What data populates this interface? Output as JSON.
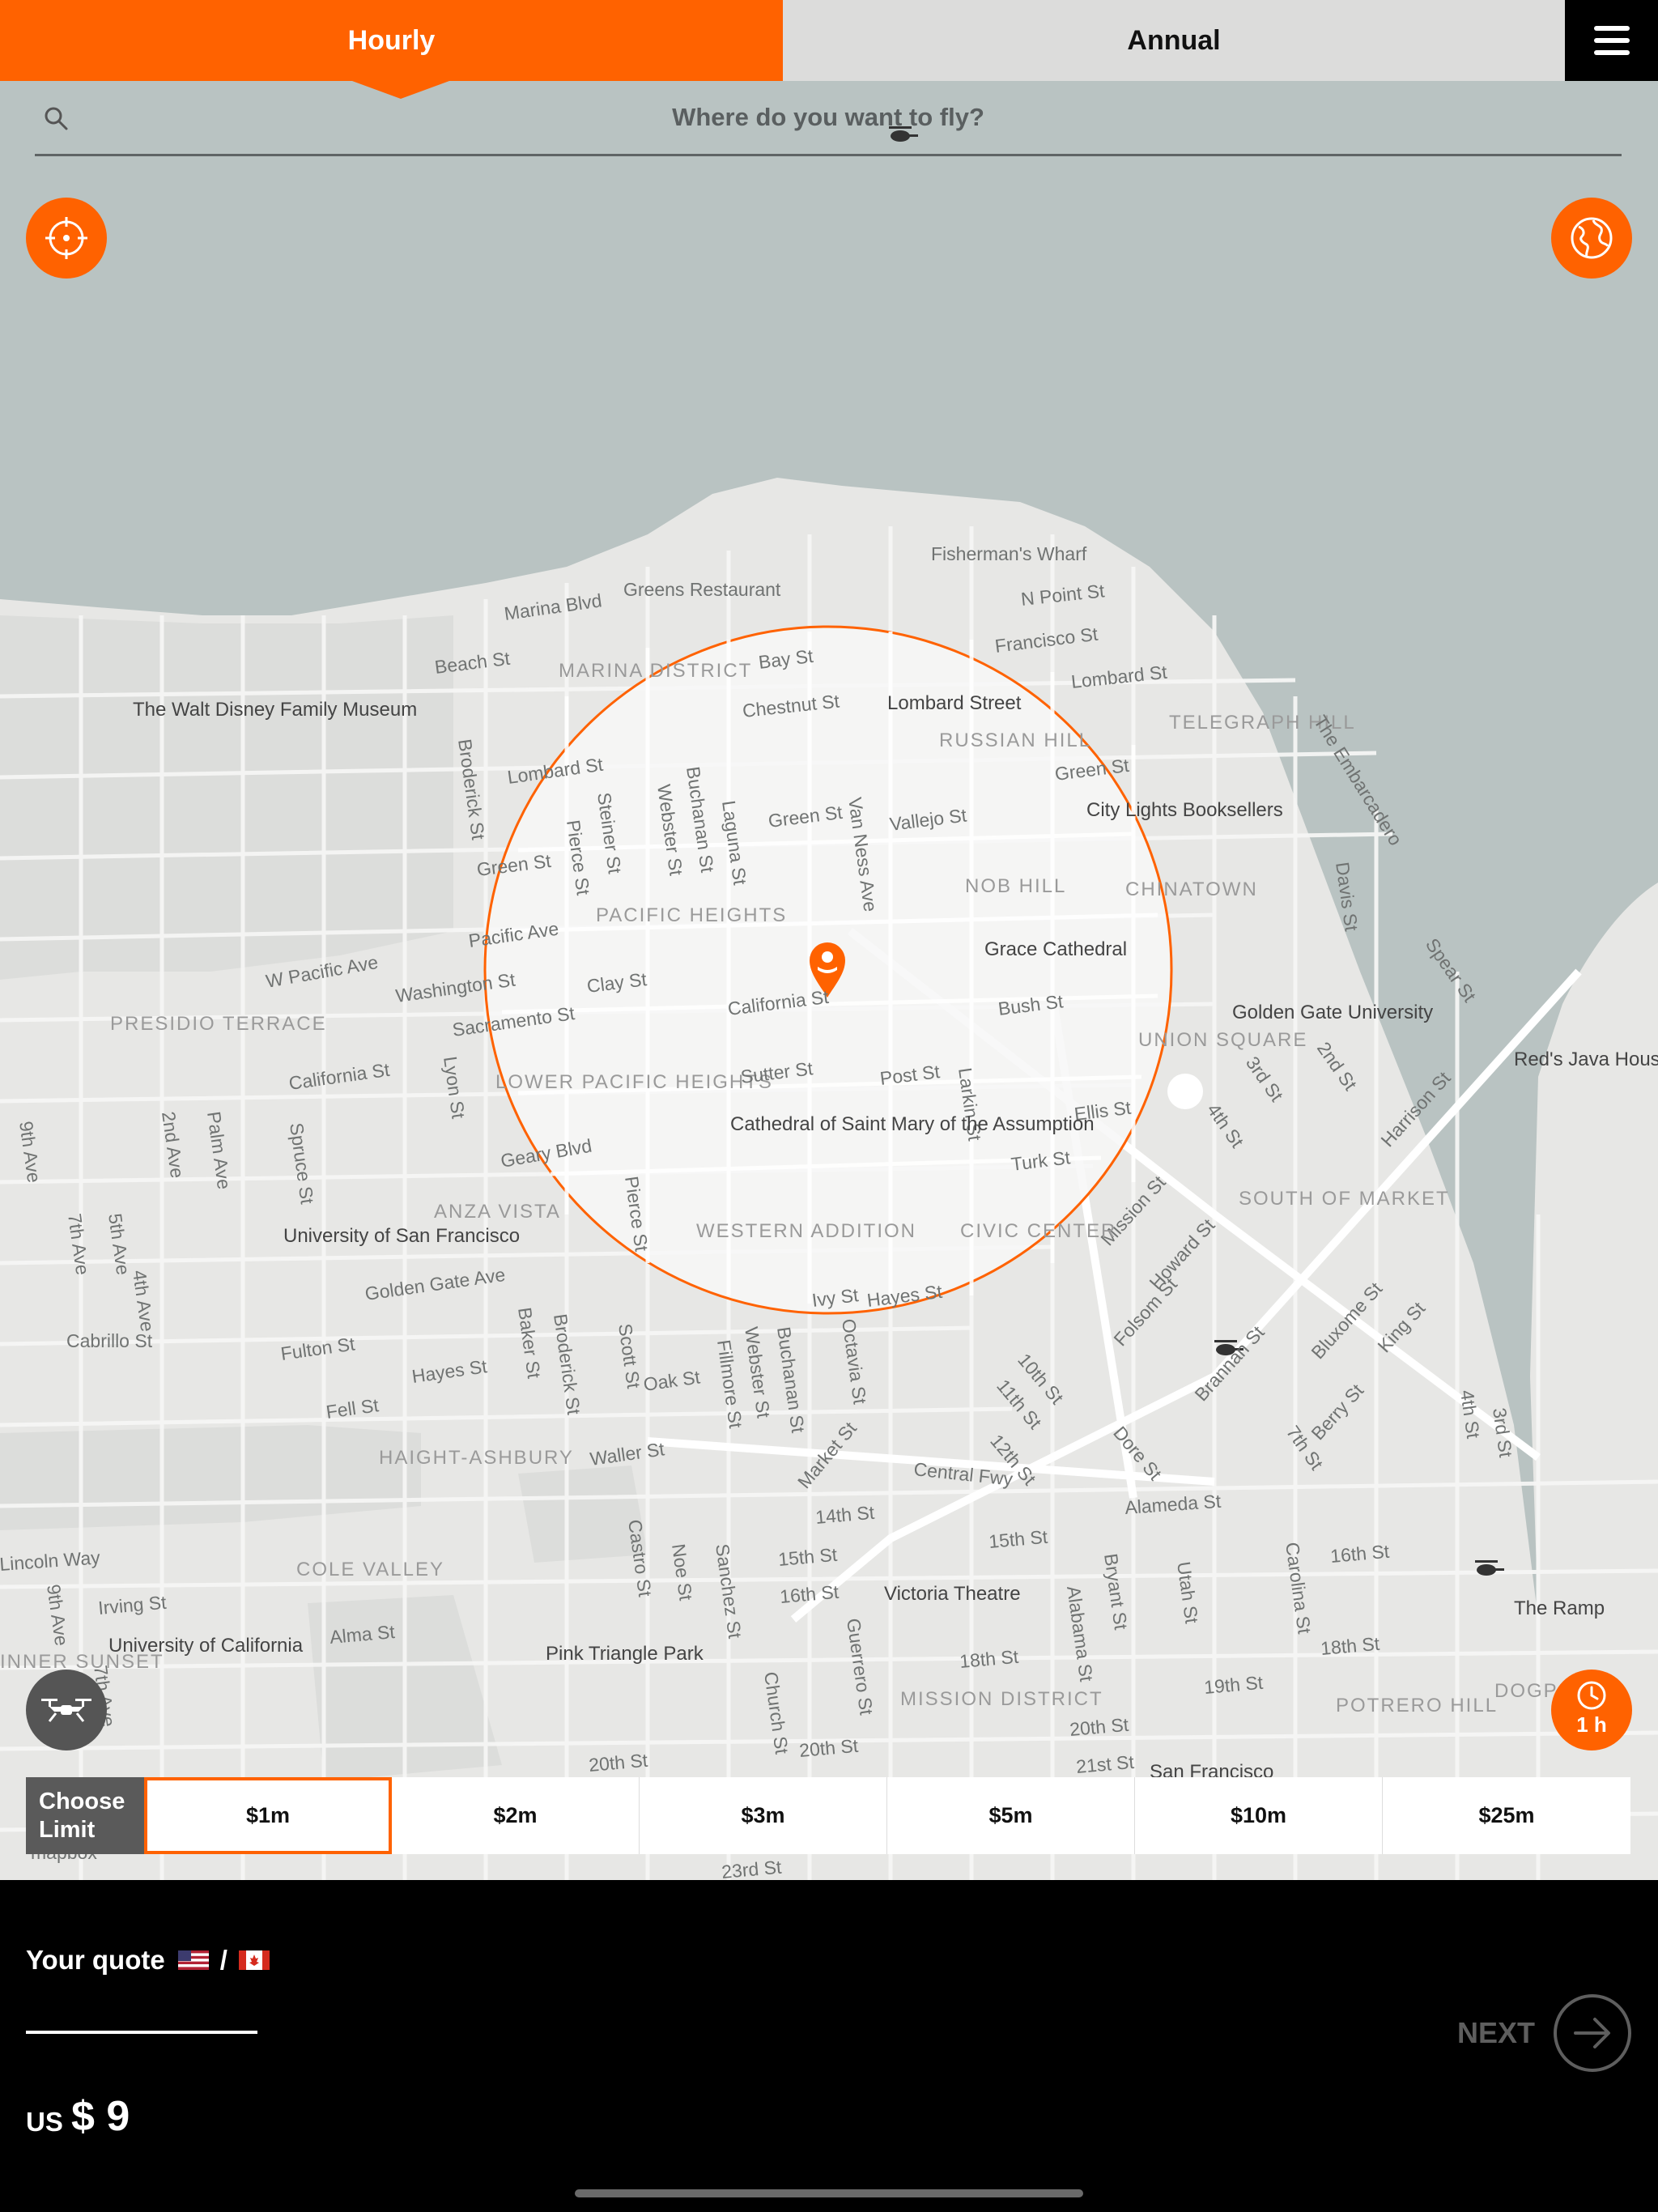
{
  "tabs": {
    "hourly": "Hourly",
    "annual": "Annual"
  },
  "search": {
    "placeholder": "Where do you want to fly?"
  },
  "map": {
    "labels": {
      "fishermans_wharf": "Fisherman's Wharf",
      "n_point_st": "N Point St",
      "greens_restaurant": "Greens Restaurant",
      "marina_blvd": "Marina Blvd",
      "bay_st": "Bay St",
      "francisco_st": "Francisco St",
      "beach_st": "Beach St",
      "marina_district": "MARINA DISTRICT",
      "chestnut_st": "Chestnut St",
      "lombard_street": "Lombard Street",
      "lombard_st_east": "Lombard St",
      "telegraph_hill": "TELEGRAPH HILL",
      "disney_museum": "The Walt Disney Family Museum",
      "russian_hill": "RUSSIAN HILL",
      "the_embarcadero": "The Embarcadero",
      "lombard_st": "Lombard St",
      "broderick_st": "Broderick St",
      "steiner_st": "Steiner St",
      "buchanan_st": "Buchanan St",
      "webster_st": "Webster St",
      "laguna_st": "Laguna St",
      "pierce_st": "Pierce St",
      "green_st": "Green St",
      "green_st_east": "Green St",
      "van_ness_ave": "Van Ness Ave",
      "vallejo_st": "Vallejo St",
      "city_lights": "City Lights Booksellers",
      "green_st_west": "Green St",
      "nob_hill": "NOB HILL",
      "chinatown": "CHINATOWN",
      "davis_st": "Davis St",
      "pacific_heights": "PACIFIC HEIGHTS",
      "pacific_ave": "Pacific Ave",
      "grace_cathedral": "Grace Cathedral",
      "spear_st": "Spear St",
      "w_pacific_ave": "W Pacific Ave",
      "washington_st": "Washington St",
      "clay_st": "Clay St",
      "california_st_mid": "California St",
      "bush_st": "Bush St",
      "golden_gate_univ": "Golden Gate University",
      "presidio_terrace": "PRESIDIO TERRACE",
      "sacramento_st": "Sacramento St",
      "union_square": "UNION SQUARE",
      "reds_java_house": "Red's Java House",
      "california_st": "California St",
      "lyon_st": "Lyon St",
      "lower_pacific_heights": "LOWER PACIFIC HEIGHTS",
      "sutter_st": "Sutter St",
      "post_st": "Post St",
      "larkin_st": "Larkin St",
      "third_st": "3rd St",
      "second_st": "2nd St",
      "harrison_st": "Harrison St",
      "ellis_st": "Ellis St",
      "fourth_st": "4th St",
      "ninth_ave": "9th Ave",
      "second_ave": "2nd Ave",
      "palm_ave": "Palm Ave",
      "spruce_st": "Spruce St",
      "geary_blvd": "Geary Blvd",
      "cathedral_st_mary": "Cathedral of Saint Mary of the Assumption",
      "turk_st": "Turk St",
      "mission_st": "Mission St",
      "howard_st": "Howard St",
      "south_of_market": "SOUTH OF MARKET",
      "anza_vista": "ANZA VISTA",
      "pierce_st_south": "Pierce St",
      "university_sf": "University of San Francisco",
      "western_addition": "WESTERN ADDITION",
      "civic_center": "CIVIC CENTER",
      "seventh_ave": "7th Ave",
      "fifth_ave": "5th Ave",
      "fourth_ave": "4th Ave",
      "golden_gate_ave": "Golden Gate Ave",
      "ivy_st": "Ivy St",
      "hayes_st_east": "Hayes St",
      "folsom_st": "Folsom St",
      "bluxome_st": "Bluxome St",
      "king_st": "King St",
      "cabrillo_st": "Cabrillo St",
      "fulton_st": "Fulton St",
      "baker_st": "Baker St",
      "broderick_st_south": "Broderick St",
      "scott_st": "Scott St",
      "oak_st": "Oak St",
      "fillmore_st": "Fillmore St",
      "webster_st_south": "Webster St",
      "buchanan_st_south": "Buchanan St",
      "octavia_st": "Octavia St",
      "tenth_st": "10th St",
      "eleventh_st": "11th St",
      "brannan_st": "Brannan St",
      "hayes_st": "Hayes St",
      "fell_st": "Fell St",
      "haight_ashbury": "HAIGHT-ASHBURY",
      "waller_st": "Waller St",
      "market_st": "Market St",
      "twelfth_st": "12th St",
      "dore_st": "Dore St",
      "berry_st": "Berry St",
      "seventh_st": "7th St",
      "fourth_st_south": "4th St",
      "third_st_south": "3rd St",
      "central_fwy": "Central Fwy",
      "fourteenth_st": "14th St",
      "alameda_st": "Alameda St",
      "lincoln_way": "Lincoln Way",
      "cole_valley": "COLE VALLEY",
      "castro_st": "Castro St",
      "noe_st": "Noe St",
      "sanchez_st": "Sanchez St",
      "fifteenth_st": "15th St",
      "fifteenth_st_east": "15th St",
      "bryant_st": "Bryant St",
      "utah_st": "Utah St",
      "carolina_st": "Carolina St",
      "sixteenth_st": "16th St",
      "ninth_ave_south": "9th Ave",
      "irving_st": "Irving St",
      "sixteenth_st_mid": "16th St",
      "victoria_theatre": "Victoria Theatre",
      "alabama_st": "Alabama St",
      "the_ramp": "The Ramp",
      "university_california": "University of California",
      "alma_st": "Alma St",
      "pink_triangle_park": "Pink Triangle Park",
      "guerrero_st": "Guerrero St",
      "eighteenth_st": "18th St",
      "eighteenth_st_east": "18th St",
      "inner_sunset": "INNER SUNSET",
      "seventh_ave_south": "7th Ave",
      "church_st": "Church St",
      "mission_district": "MISSION DISTRICT",
      "nineteenth_st": "19th St",
      "potrero_hill": "POTRERO HILL",
      "dogpatch": "DOGPATCH",
      "twentieth_st": "20th St",
      "twentieth_st_mid": "20th St",
      "twentieth_st_east": "20th St",
      "twentyfirst_st": "21st St",
      "san_francisco": "San Francisco",
      "twentythird_st": "23rd St",
      "mapbox": "mapbox"
    }
  },
  "time_button": {
    "label": "1 h"
  },
  "limit": {
    "choose_label": "Choose Limit",
    "options": [
      "$1m",
      "$2m",
      "$3m",
      "$5m",
      "$10m",
      "$25m"
    ],
    "selected": "$1m"
  },
  "quote": {
    "label": "Your quote",
    "separator": "/",
    "currency": "US",
    "amount": "$ 9"
  },
  "next": {
    "label": "NEXT"
  },
  "colors": {
    "accent": "#ff6200",
    "water": "#b9c3c2",
    "land": "#e7e7e5",
    "circle_fill": "#f7f7f7"
  },
  "icons": [
    "search-icon",
    "locate-icon",
    "globe-icon",
    "menu-icon",
    "drone-icon",
    "clock-icon",
    "map-pin-icon",
    "arrow-right-icon",
    "us-flag-icon",
    "canada-flag-icon",
    "helicopter-icon"
  ]
}
